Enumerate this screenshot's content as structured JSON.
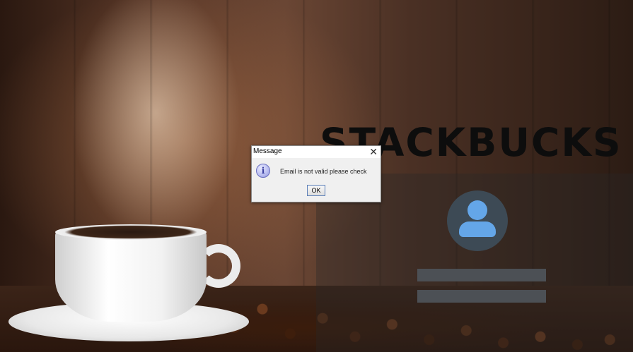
{
  "app": {
    "brand_title": "STACKBUCKS"
  },
  "login_panel": {
    "avatar_icon": "user-avatar-icon",
    "email_field_value": "",
    "password_field_value": ""
  },
  "dialog": {
    "title": "Message",
    "close_glyph": "✕",
    "icon": "info-icon",
    "icon_glyph": "i",
    "message": "Email is not valid please check",
    "ok_label": "OK"
  },
  "colors": {
    "avatar_bg": "#3d4a55",
    "avatar_fg": "#64a6e8",
    "field_bg": "#4c5055",
    "brand_text": "#0d0d0d"
  }
}
